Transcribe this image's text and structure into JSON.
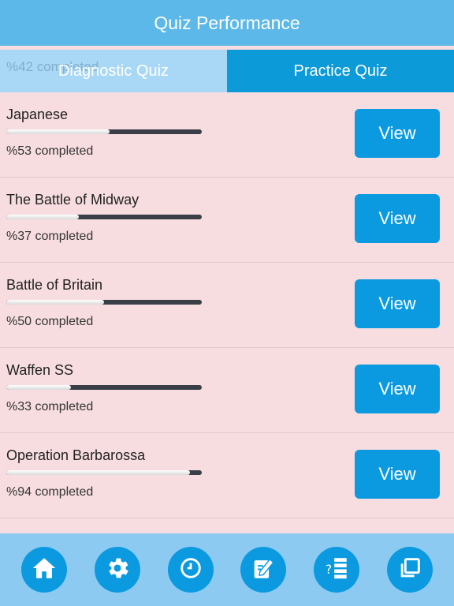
{
  "header": {
    "title": "Quiz Performance"
  },
  "tabs": [
    {
      "label": "Diagnostic Quiz",
      "ghost_text": "%42 completed"
    },
    {
      "label": "Practice Quiz"
    }
  ],
  "quizzes": [
    {
      "title": "Japanese",
      "progress": 0.53,
      "status": "%53 completed",
      "button": "View"
    },
    {
      "title": "The Battle of Midway",
      "progress": 0.37,
      "status": "%37 completed",
      "button": "View"
    },
    {
      "title": "Battle of Britain",
      "progress": 0.5,
      "status": "%50 completed",
      "button": "View"
    },
    {
      "title": "Waffen SS",
      "progress": 0.33,
      "status": "%33 completed",
      "button": "View"
    },
    {
      "title": "Operation Barbarossa",
      "progress": 0.94,
      "status": "%94 completed",
      "button": "View"
    }
  ],
  "bottom_nav": [
    {
      "icon": "home-icon"
    },
    {
      "icon": "gear-icon"
    },
    {
      "icon": "clock-icon"
    },
    {
      "icon": "edit-note-icon"
    },
    {
      "icon": "question-list-icon"
    },
    {
      "icon": "copy-icon"
    }
  ],
  "colors": {
    "header": "#5cb8e8",
    "active_tab": "#0d9ad8",
    "button": "#0b9ae0",
    "background": "#f7dde0"
  }
}
